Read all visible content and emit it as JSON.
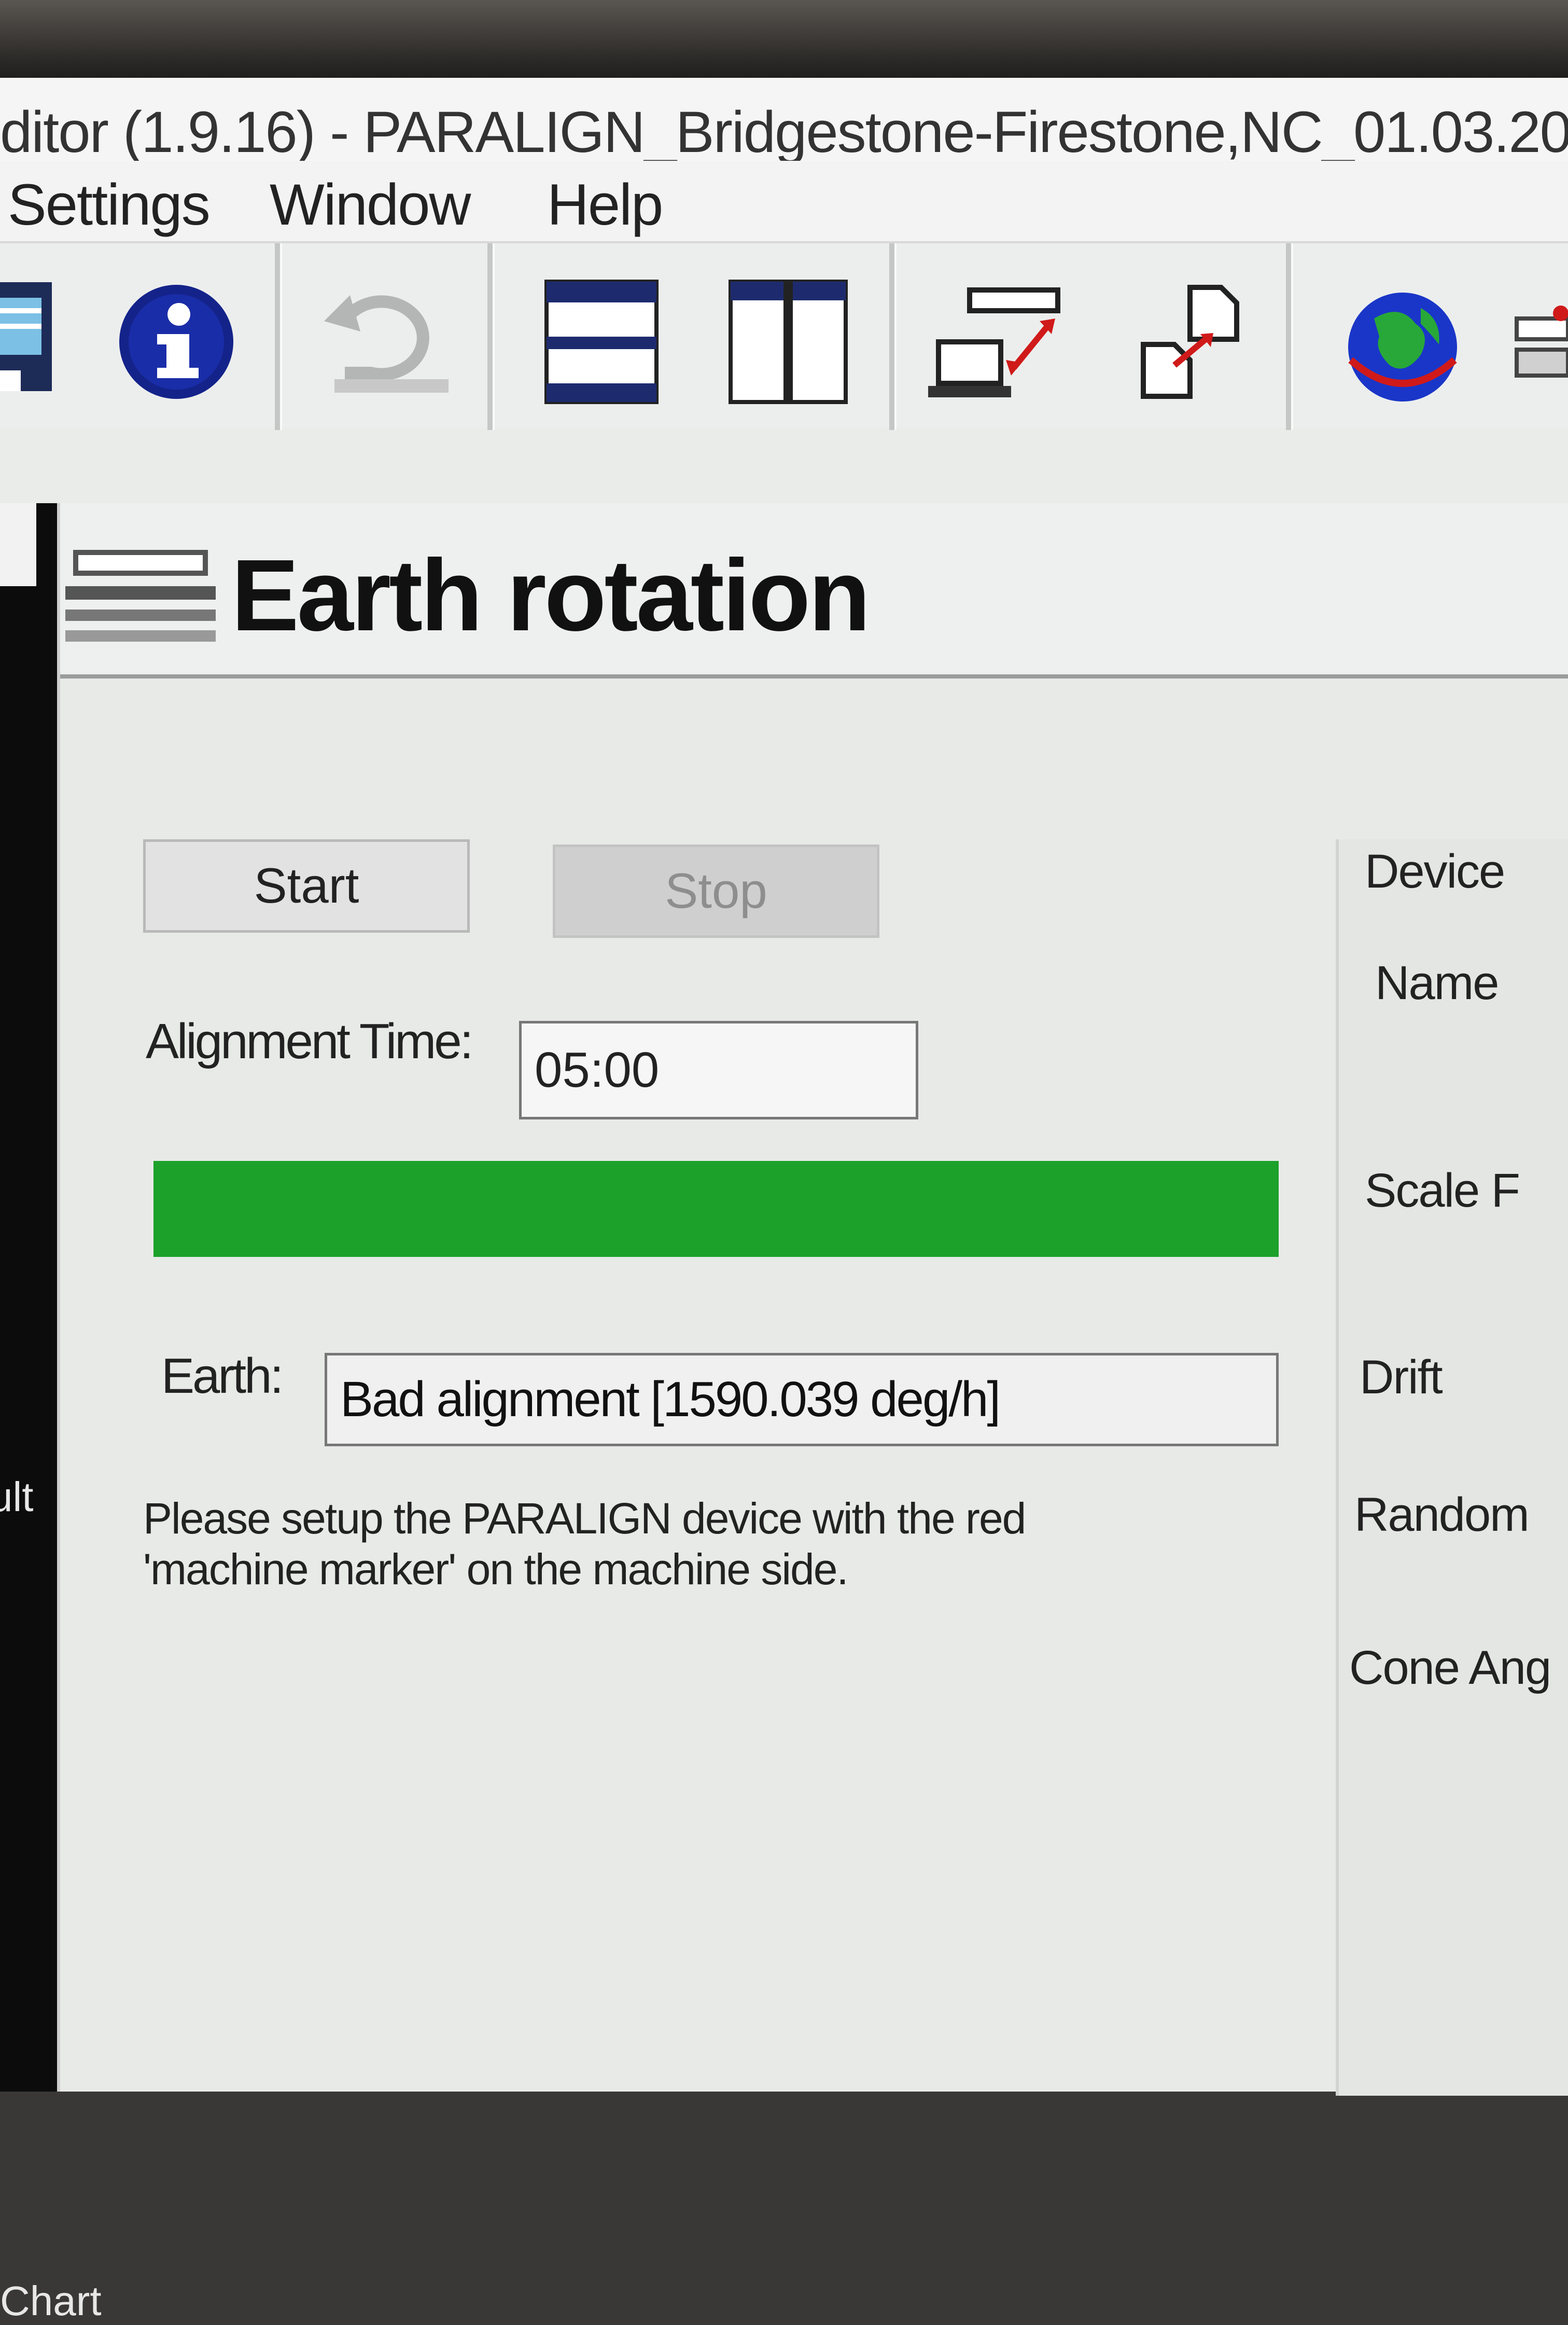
{
  "window": {
    "title": "ditor (1.9.16) - PARALIGN_Bridgestone-Firestone,NC_01.03.20"
  },
  "menu": {
    "items": [
      "Settings",
      "Window",
      "Help"
    ]
  },
  "toolbar": {
    "icons": [
      "save-icon",
      "info-icon",
      "undo-icon",
      "horizontal-split-icon",
      "vertical-split-icon",
      "computer-transfer-icon",
      "file-transfer-icon",
      "globe-icon",
      "device-icon"
    ]
  },
  "left_panel": {
    "labels": [
      "ult",
      "Chart"
    ]
  },
  "panel": {
    "title": "Earth rotation",
    "start_label": "Start",
    "stop_label": "Stop",
    "alignment_label": "Alignment Time:",
    "alignment_value": "05:00",
    "progress": 1.0,
    "earth_label": "Earth:",
    "earth_value": "Bad alignment [1590.039 deg/h]",
    "instruction_line1": "Please setup the PARALIGN device with the red",
    "instruction_line2": "'machine marker' on the machine side."
  },
  "device": {
    "heading": "Device",
    "labels": [
      "Name",
      "Scale F",
      "Drift",
      "Random",
      "Cone Ang"
    ]
  },
  "colors": {
    "progress": "#1ca12a",
    "info_blue": "#14238a",
    "globe_blue": "#1a36c8",
    "globe_green": "#28a838",
    "transfer_red": "#d01a1a"
  }
}
